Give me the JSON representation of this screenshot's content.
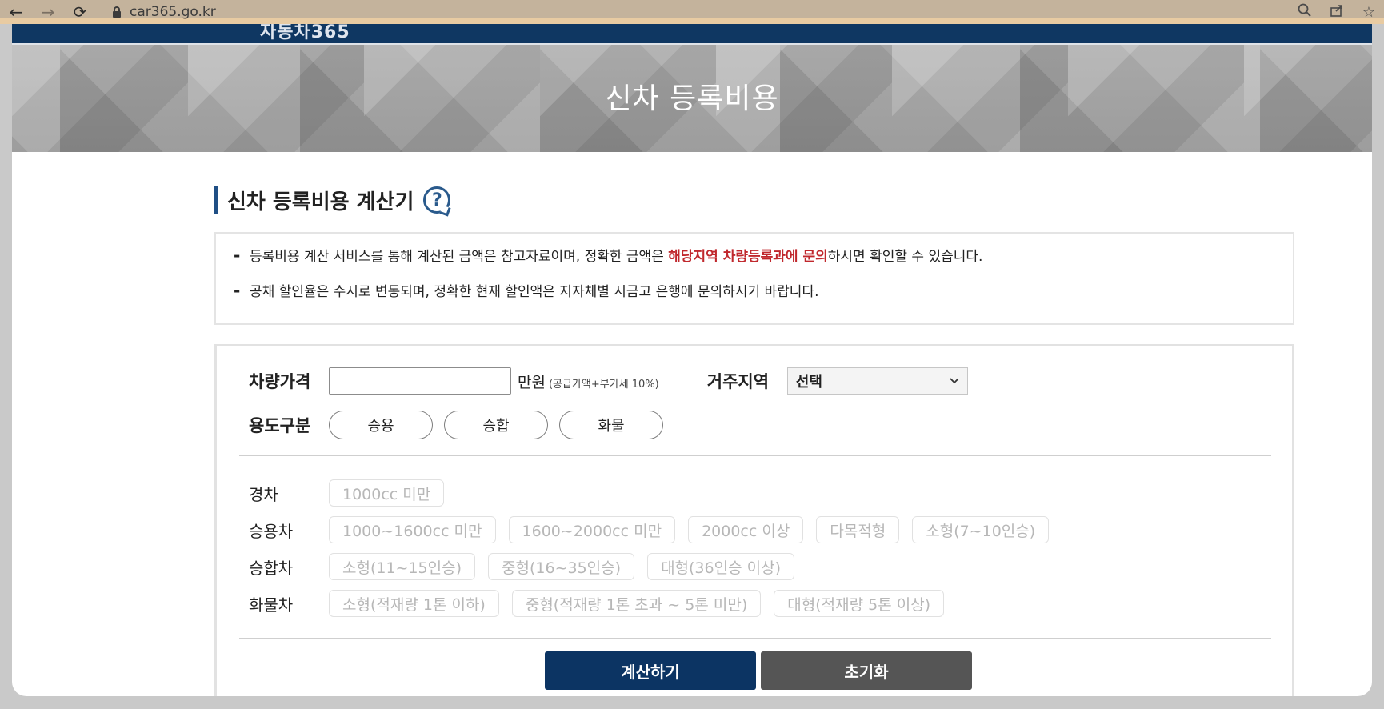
{
  "browser": {
    "back_icon": "←",
    "forward_icon": "→",
    "reload_icon": "⟳",
    "url": "car365.go.kr",
    "zoom_icon": "🔍",
    "share_icon": "⇪",
    "bookmark_icon": "☆"
  },
  "header": {
    "logo_text": "자동차365",
    "hero_title": "신차 등록비용"
  },
  "section": {
    "title": "신차 등록비용 계산기",
    "help_glyph": "?"
  },
  "notice": {
    "line1_pre": "등록비용 계산 서비스를 통해 계산된 금액은 참고자료이며, 정확한 금액은 ",
    "line1_highlight": "해당지역 차량등록과에 문의",
    "line1_post": "하시면 확인할 수 있습니다.",
    "line2": "공채 할인율은 수시로 변동되며, 정확한 현재 할인액은 지자체별 시금고 은행에 문의하시기 바랍니다."
  },
  "form": {
    "price_label": "차량가격",
    "price_value": "",
    "price_unit": "만원",
    "price_note": "(공급가액+부가세 10%)",
    "region_label": "거주지역",
    "region_selected": "선택",
    "usage_label": "용도구분",
    "usage_options": [
      "승용",
      "승합",
      "화물"
    ]
  },
  "vehicle_types": [
    {
      "label": "경차",
      "options": [
        "1000cc 미만"
      ]
    },
    {
      "label": "승용차",
      "options": [
        "1000~1600cc 미만",
        "1600~2000cc 미만",
        "2000cc 이상",
        "다목적형",
        "소형(7~10인승)"
      ]
    },
    {
      "label": "승합차",
      "options": [
        "소형(11~15인승)",
        "중형(16~35인승)",
        "대형(36인승 이상)"
      ]
    },
    {
      "label": "화물차",
      "options": [
        "소형(적재량 1톤 이하)",
        "중형(적재량 1톤 초과 ~ 5톤 미만)",
        "대형(적재량 5톤 이상)"
      ]
    }
  ],
  "buttons": {
    "calculate": "계산하기",
    "reset": "초기화"
  },
  "colors": {
    "accent": "#0c3463",
    "highlight": "#c0282d",
    "reset": "#555555"
  }
}
